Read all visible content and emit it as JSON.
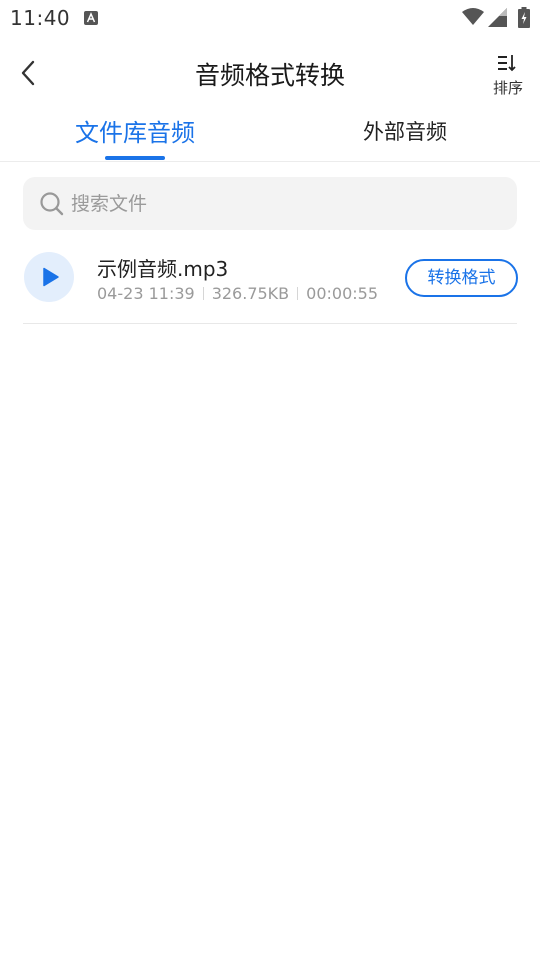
{
  "status_bar": {
    "time": "11:40"
  },
  "header": {
    "title": "音频格式转换",
    "sort_label": "排序"
  },
  "tabs": [
    {
      "label": "文件库音频",
      "active": true
    },
    {
      "label": "外部音频",
      "active": false
    }
  ],
  "search": {
    "placeholder": "搜索文件",
    "value": ""
  },
  "files": [
    {
      "name": "示例音频.mp3",
      "date": "04-23 11:39",
      "size": "326.75KB",
      "duration": "00:00:55",
      "action_label": "转换格式"
    }
  ],
  "colors": {
    "accent": "#1a73e8",
    "play_bg": "#e3eefc",
    "search_bg": "#f3f3f3"
  }
}
